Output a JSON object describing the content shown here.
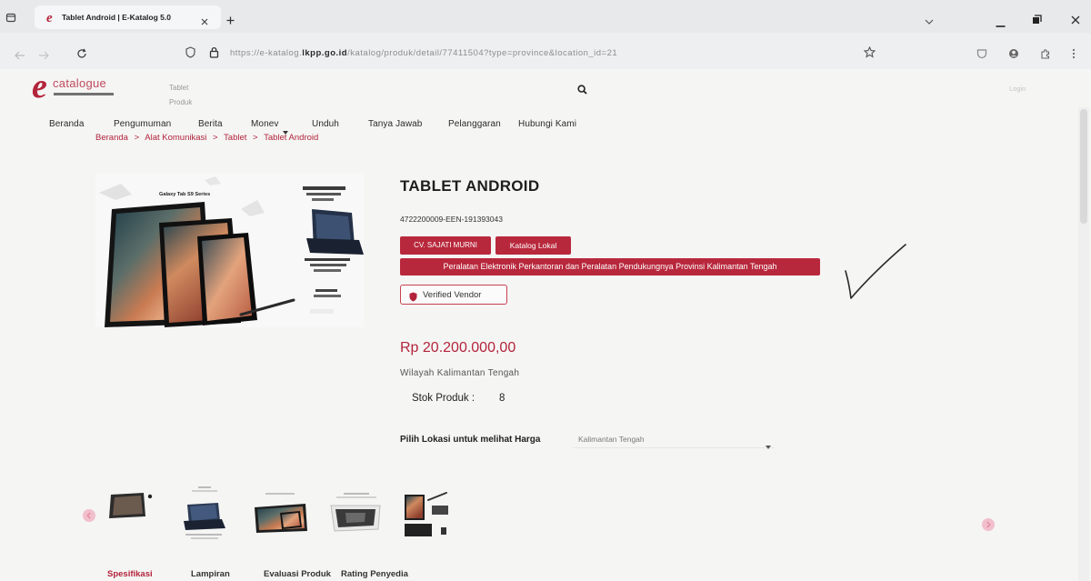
{
  "browser": {
    "favicon_glyph": "e",
    "tab_title": "Tablet Android | E-Katalog 5.0",
    "url_scheme": "https://e-katalog.",
    "url_domain": "lkpp.go.id",
    "url_path": "/katalog/produk/detail/77411504?type=province&location_id=21"
  },
  "header": {
    "logo_mark": "e",
    "logo_text": "catalogue",
    "search_value": "Tablet",
    "search_category": "Produk",
    "login_label": "Login"
  },
  "nav": {
    "items": [
      "Beranda",
      "Pengumuman",
      "Berita",
      "Monev",
      "Unduh",
      "Tanya Jawab",
      "Pelanggaran",
      "Hubungi Kami"
    ]
  },
  "breadcrumb": {
    "items": [
      "Beranda",
      "Alat Komunikasi",
      "Tablet",
      "Tablet Android"
    ],
    "separator": ">"
  },
  "product": {
    "image_caption": "Galaxy Tab S9 Series",
    "title": "TABLET ANDROID",
    "code": "4722200009-EEN-191393043",
    "badges": [
      "CV. SAJATI MURNI",
      "Katalog Lokal",
      "Peralatan Elektronik Perkantoran dan Peralatan Pendukungnya Provinsi Kalimantan Tengah"
    ],
    "verified_label": "Verified Vendor",
    "price": "Rp 20.200.000,00",
    "region": "Wilayah Kalimantan Tengah",
    "stock_label": "Stok Produk :",
    "stock_value": "8",
    "location_label": "Pilih Lokasi untuk melihat Harga",
    "location_value": "Kalimantan Tengah"
  },
  "tabs": [
    {
      "label": "Spesifikasi",
      "active": true
    },
    {
      "label": "Lampiran",
      "active": false
    },
    {
      "label": "Evaluasi Produk",
      "active": false
    },
    {
      "label": "Rating Penyedia",
      "active": false
    }
  ],
  "colors": {
    "accent": "#b3243b",
    "badge": "#b8283c",
    "carousel_arrow": "#f2bfcc",
    "ink_checkmark": "#2a2a2a"
  },
  "icons": [
    "tab-overview-icon",
    "favicon-icon",
    "tab-close-icon",
    "new-tab-icon",
    "chevron-down-icon",
    "minimize-icon",
    "restore-icon",
    "close-icon",
    "back-arrow-icon",
    "forward-arrow-icon",
    "reload-icon",
    "shield-icon",
    "lock-icon",
    "star-icon",
    "pocket-icon",
    "account-icon",
    "extension-icon",
    "menu-icon",
    "search-icon",
    "verified-shield-icon",
    "chevron-left-icon",
    "chevron-right-icon"
  ]
}
